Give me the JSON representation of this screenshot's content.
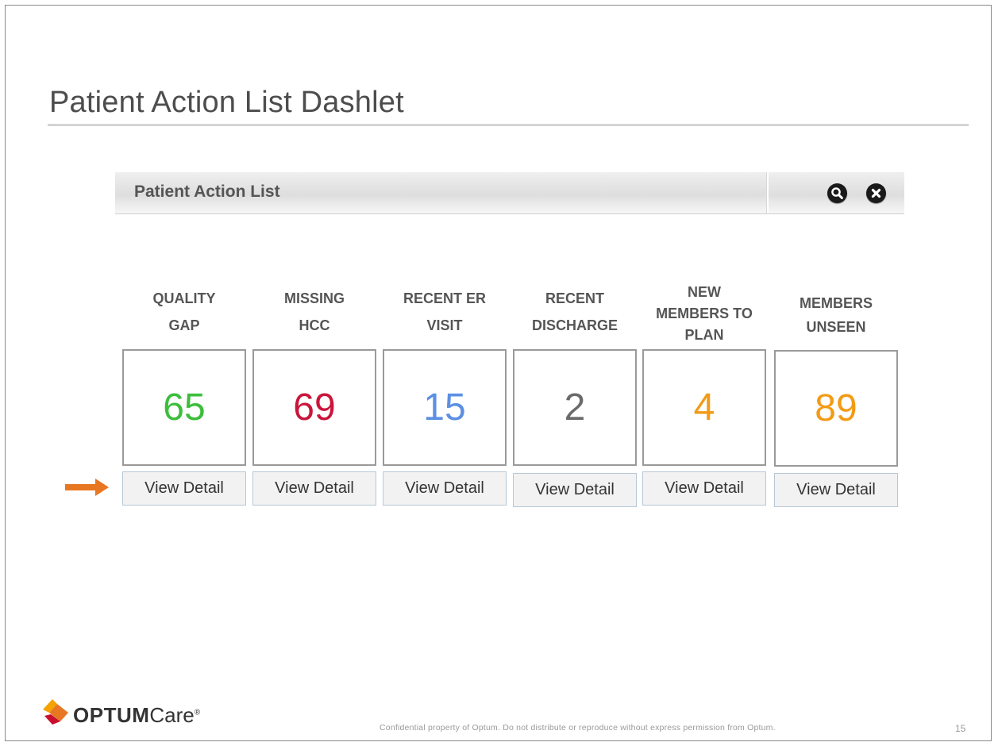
{
  "slide": {
    "title": "Patient Action List Dashlet",
    "footer_note": "Confidential property of Optum. Do not distribute or reproduce without express permission from Optum.",
    "page_number": "15"
  },
  "logo": {
    "brand": "OPTUM",
    "product": "Care",
    "mark": "®",
    "colors": [
      "#f4a300",
      "#e87722",
      "#c8102e"
    ]
  },
  "dashlet": {
    "title": "Patient Action List",
    "icons": [
      "search-icon",
      "close-icon"
    ]
  },
  "tiles": [
    {
      "label_lines": [
        "QUALITY",
        "GAP"
      ],
      "value": "65",
      "color": "#3cbe3c",
      "button": "View Detail"
    },
    {
      "label_lines": [
        "MISSING",
        "HCC"
      ],
      "value": "69",
      "color": "#c9163b",
      "button": "View Detail"
    },
    {
      "label_lines": [
        "RECENT ER",
        "VISIT"
      ],
      "value": "15",
      "color": "#5b8fe3",
      "button": "View Detail"
    },
    {
      "label_lines": [
        "RECENT",
        "DISCHARGE"
      ],
      "value": "2",
      "color": "#6a6a6a",
      "button": "View Detail"
    },
    {
      "label_lines": [
        "NEW",
        "MEMBERS TO",
        "PLAN"
      ],
      "value": "4",
      "color": "#f29b14",
      "button": "View Detail"
    },
    {
      "label_lines": [
        "MEMBERS",
        "UNSEEN"
      ],
      "value": "89",
      "color": "#f29b14",
      "button": "View Detail"
    }
  ],
  "indicator": {
    "icon": "arrow-right-icon",
    "color": "#e87722"
  }
}
